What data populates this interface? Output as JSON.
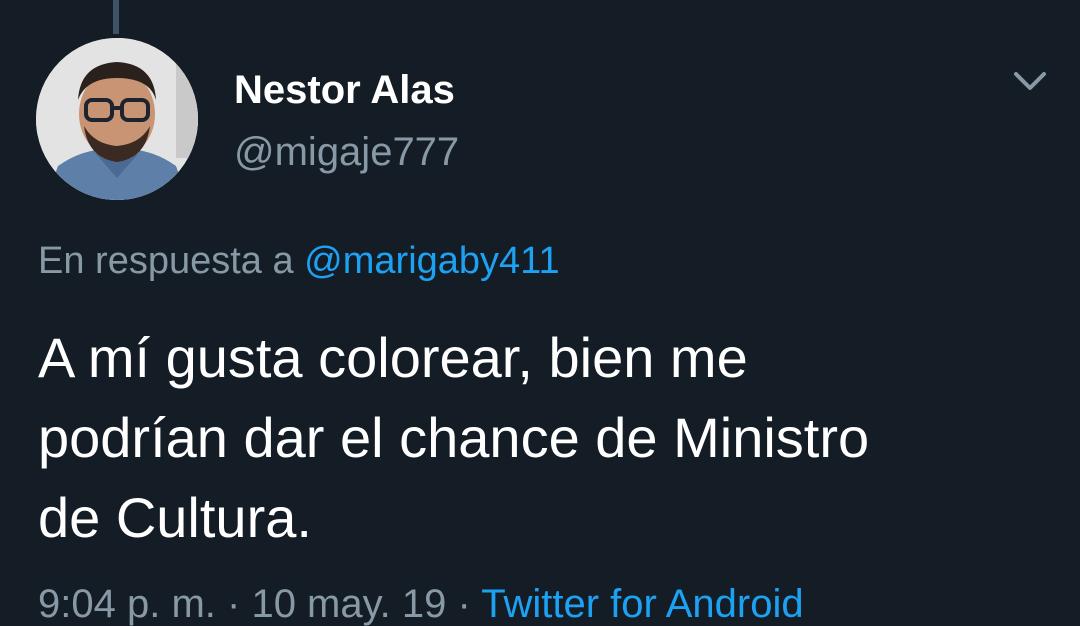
{
  "tweet": {
    "author": {
      "display_name": "Nestor Alas",
      "handle": "@migaje777",
      "avatar_icon": "profile-photo"
    },
    "reply": {
      "prefix": "En respuesta a",
      "mention": "@marigaby411"
    },
    "text_lines": [
      "A mí gusta colorear, bien me",
      "podrían dar el chance de Ministro",
      "de Cultura."
    ],
    "meta": {
      "time": "9:04 p. m.",
      "separator": "·",
      "date": "10 may. 19",
      "source": "Twitter for Android"
    },
    "menu_icon": "chevron-down-icon"
  },
  "colors": {
    "background": "#141d26",
    "primary_text": "#ffffff",
    "secondary_text": "#8899a6",
    "link": "#1da1f2",
    "thread_line": "#3d5466"
  }
}
